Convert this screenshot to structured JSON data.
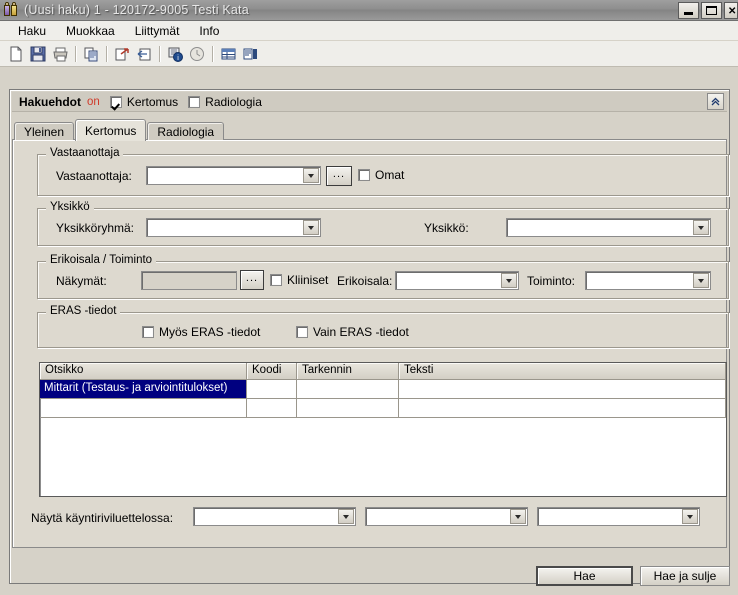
{
  "window": {
    "title": "(Uusi haku) 1 - 120172-9005 Testi Kata",
    "app_icon": "people-icon",
    "controls": {
      "minimize": "minimize-icon",
      "maximize": "maximize-icon",
      "close": "close-icon"
    }
  },
  "menubar": {
    "items": [
      {
        "label": "Haku"
      },
      {
        "label": "Muokkaa"
      },
      {
        "label": "Liittymät"
      },
      {
        "label": "Info"
      }
    ]
  },
  "toolbar": {
    "buttons": [
      {
        "name": "new-document-icon"
      },
      {
        "name": "save-icon"
      },
      {
        "name": "print-icon"
      },
      {
        "name": "copy-icon"
      },
      {
        "name": "export-icon"
      },
      {
        "name": "import-icon"
      },
      {
        "name": "info-icon"
      },
      {
        "name": "history-clock-icon"
      },
      {
        "name": "table-view-icon"
      },
      {
        "name": "report-icon"
      }
    ]
  },
  "panel": {
    "title": "Hakuehdot",
    "state_label": "on",
    "checkboxes": [
      {
        "label": "Kertomus",
        "checked": true
      },
      {
        "label": "Radiologia",
        "checked": false
      }
    ],
    "collapse_icon": "chevron-double-up-icon"
  },
  "tabs": [
    {
      "label": "Yleinen",
      "active": false
    },
    {
      "label": "Kertomus",
      "active": true
    },
    {
      "label": "Radiologia",
      "active": false
    }
  ],
  "groups": {
    "vastaanottaja": {
      "title": "Vastaanottaja",
      "field_label": "Vastaanottaja:",
      "field_value": "",
      "browse_label": "...",
      "checkbox": {
        "label": "Omat",
        "checked": false
      }
    },
    "yksikko": {
      "title": "Yksikkö",
      "group_label": "Yksikköryhmä:",
      "group_value": "",
      "unit_label": "Yksikkö:",
      "unit_value": ""
    },
    "erikoisala": {
      "title": "Erikoisala / Toiminto",
      "views_label": "Näkymät:",
      "views_value": "",
      "browse_label": "...",
      "checkbox": {
        "label": "Kliiniset",
        "checked": false
      },
      "specialty_label": "Erikoisala:",
      "specialty_value": "",
      "action_label": "Toiminto:",
      "action_value": ""
    },
    "eras": {
      "title": "ERAS -tiedot",
      "checkboxes": [
        {
          "label": "Myös ERAS -tiedot",
          "checked": false
        },
        {
          "label": "Vain ERAS -tiedot",
          "checked": false
        }
      ]
    }
  },
  "grid": {
    "columns": [
      "Otsikko",
      "Koodi",
      "Tarkennin",
      "Teksti"
    ],
    "rows": [
      {
        "selected": true,
        "cells": [
          "Mittarit (Testaus- ja arviointitulokset)",
          "",
          "",
          ""
        ]
      },
      {
        "selected": false,
        "cells": [
          "",
          "",
          "",
          ""
        ]
      }
    ]
  },
  "visit_list": {
    "label": "Näytä käyntiriviluettelossa:",
    "combo1": "",
    "combo2": "",
    "combo3": ""
  },
  "footer": {
    "search_button": "Hae",
    "search_close_button": "Hae ja sulje"
  },
  "colors": {
    "selection": "#000080",
    "accent_red": "#d03a2a",
    "window_bg": "#d6d2c8"
  }
}
